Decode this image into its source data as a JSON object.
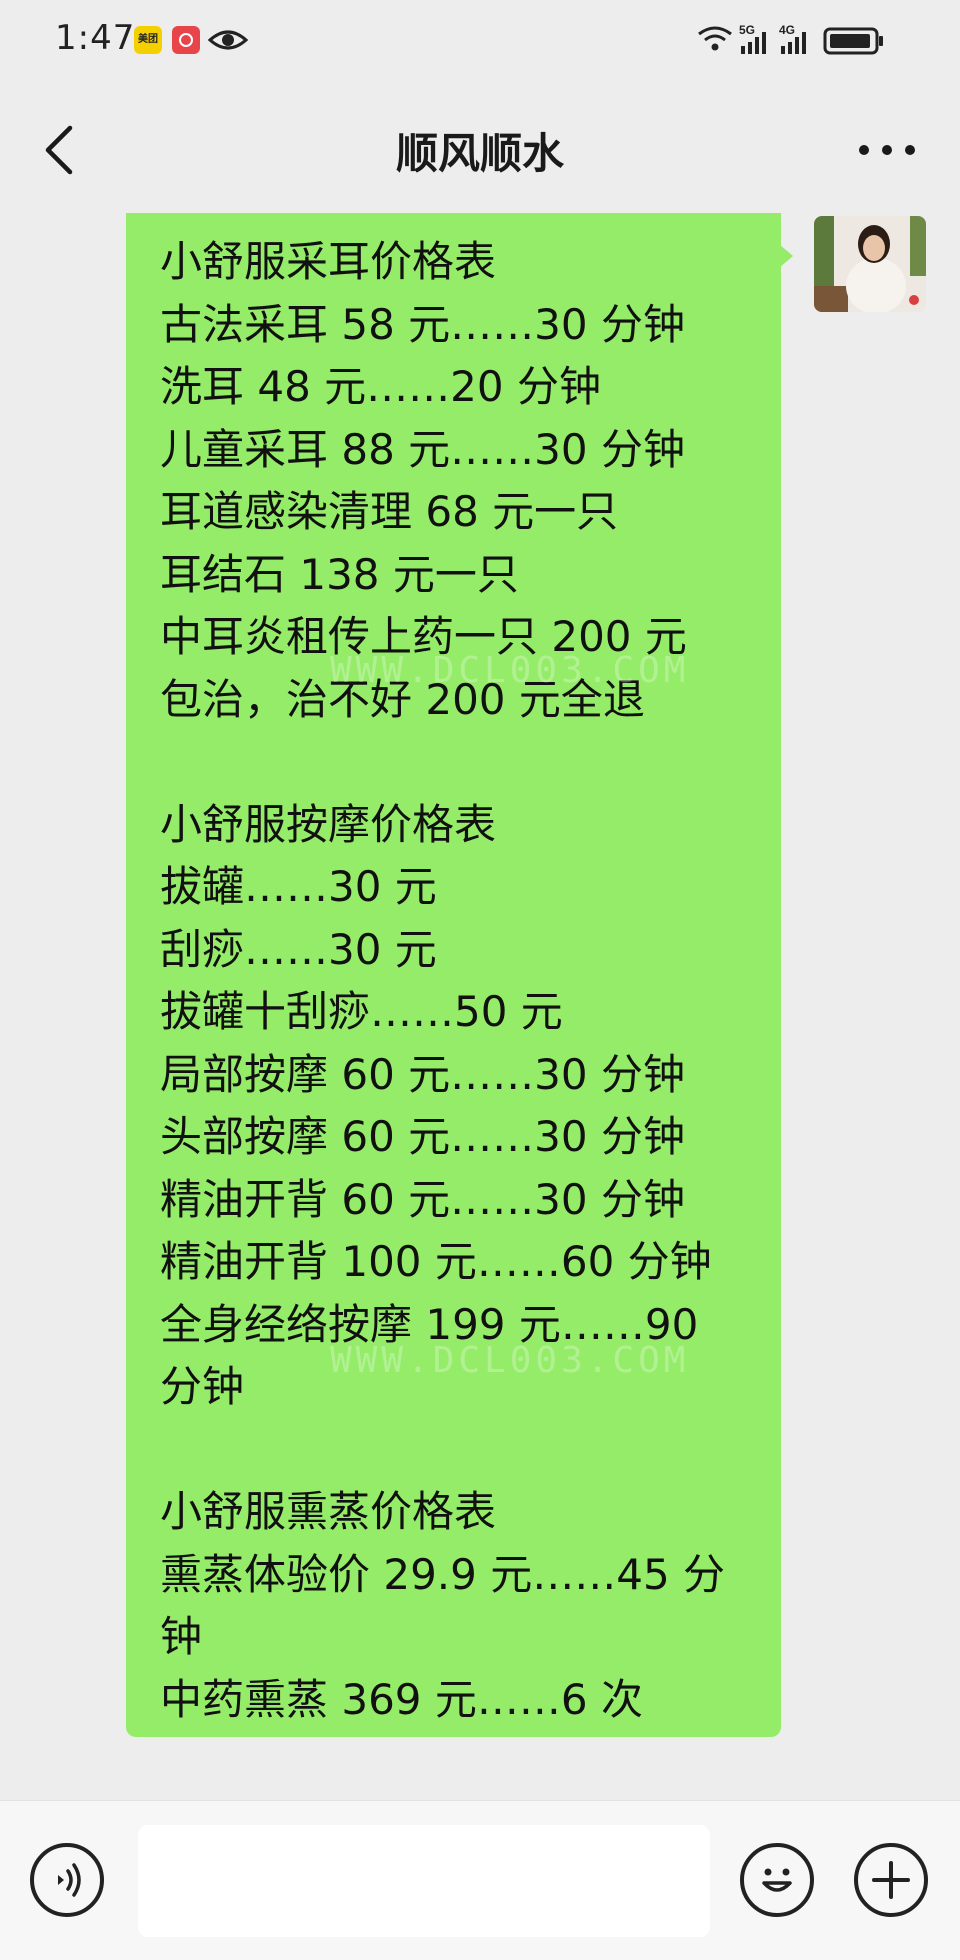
{
  "status_bar": {
    "time": "1:47",
    "app_icon_1_label": "美团",
    "network_1": "5G",
    "network_2": "4G",
    "icons": [
      "meituan-app-icon",
      "huawei-app-icon",
      "eye-icon",
      "wifi-icon",
      "signal-5g-icon",
      "signal-4g-icon",
      "battery-icon"
    ]
  },
  "header": {
    "title": "顺风顺水",
    "back_icon": "chevron-left-icon",
    "more_icon": "more-dots-icon"
  },
  "message": {
    "bubble_color": "#95ec69",
    "lines": [
      "小舒服采耳价格表",
      "古法采耳 58 元……30 分钟",
      "洗耳 48 元……20 分钟",
      "儿童采耳 88 元……30 分钟",
      "耳道感染清理 68 元一只",
      "耳结石 138 元一只",
      "中耳炎租传上药一只 200 元",
      "包治，治不好 200 元全退",
      "",
      "小舒服按摩价格表",
      "拔罐……30 元",
      "刮痧……30 元",
      "拔罐十刮痧……50 元",
      "局部按摩 60 元……30 分钟",
      "头部按摩 60 元……30 分钟",
      "精油开背 60 元……30 分钟",
      "精油开背 100 元……60 分钟",
      "全身经络按摩 199 元……90",
      "分钟",
      "",
      "小舒服熏蒸价格表",
      "熏蒸体验价 29.9 元……45 分",
      "钟",
      "中药熏蒸 369 元……6 次"
    ],
    "watermarks": [
      "WWW.DCL003.COM",
      "WWW.DCL003.COM"
    ]
  },
  "input_bar": {
    "text_value": "",
    "voice_icon": "voice-icon",
    "emoji_icon": "emoji-icon",
    "plus_icon": "plus-icon"
  },
  "colors": {
    "background": "#ededed",
    "bubble": "#95ec69",
    "input_bar": "#f7f7f7"
  }
}
